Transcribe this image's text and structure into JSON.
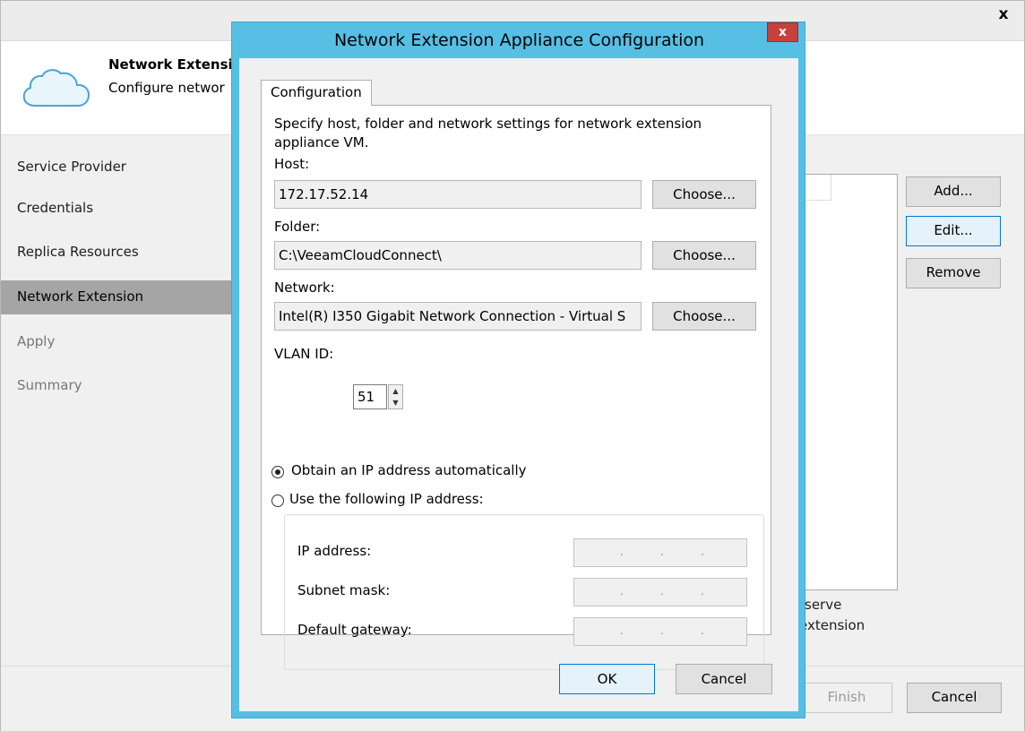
{
  "wizard": {
    "close_label": "x",
    "heading": "Network Extensi",
    "subheading": "Configure networ",
    "nav": [
      {
        "label": "Service Provider",
        "state": "normal"
      },
      {
        "label": "Credentials",
        "state": "normal"
      },
      {
        "label": "Replica Resources",
        "state": "normal"
      },
      {
        "label": "Network Extension",
        "state": "active"
      },
      {
        "label": "Apply",
        "state": "disabled"
      },
      {
        "label": "Summary",
        "state": "disabled"
      }
    ],
    "buttons": {
      "add": "Add...",
      "edit": "Edit...",
      "remove": "Remove"
    },
    "hint_line1": "serve",
    "hint_line2": "extension",
    "footer": {
      "finish": "Finish",
      "cancel": "Cancel"
    }
  },
  "dialog": {
    "title": "Network Extension Appliance Configuration",
    "close_label": "x",
    "tab": "Configuration",
    "description_line1": "Specify host, folder and network settings for network extension",
    "description_line2": "appliance VM.",
    "host": {
      "label": "Host:",
      "value": "172.17.52.14",
      "button": "Choose..."
    },
    "folder": {
      "label": "Folder:",
      "value": "C:\\VeeamCloudConnect\\",
      "button": "Choose..."
    },
    "network": {
      "label": "Network:",
      "value": "Intel(R) I350 Gigabit Network Connection - Virtual S",
      "button": "Choose..."
    },
    "vlan": {
      "label": "VLAN ID:",
      "value": "51"
    },
    "radio_auto": {
      "label": "Obtain an IP address automatically",
      "checked": true
    },
    "radio_manual": {
      "label": "Use the following IP address:",
      "checked": false
    },
    "ip_address": {
      "label": "IP address:"
    },
    "subnet_mask": {
      "label": "Subnet mask:"
    },
    "default_gateway": {
      "label": "Default gateway:"
    },
    "ok": "OK",
    "cancel": "Cancel"
  },
  "colors": {
    "dialog_frame": "#57bfe4",
    "close_button": "#c7413a",
    "nav_active": "#a5a5a5",
    "focus_border": "#0078d7"
  }
}
